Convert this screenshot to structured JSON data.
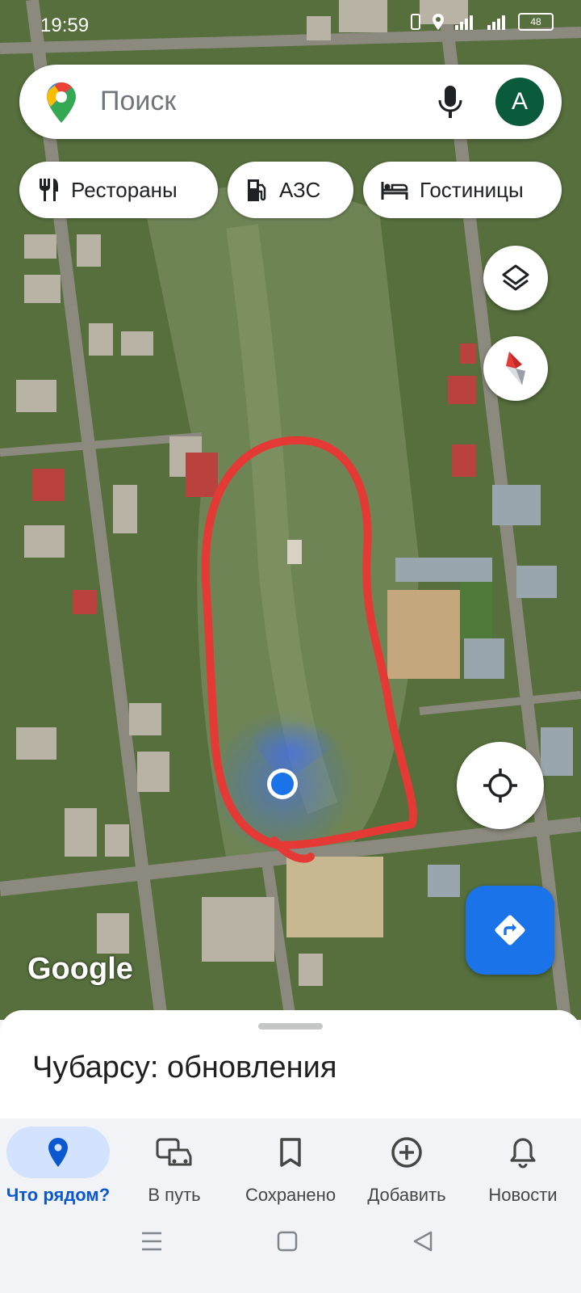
{
  "status_bar": {
    "time": "19:59",
    "battery": "48"
  },
  "search": {
    "placeholder": "Поиск",
    "avatar_letter": "А"
  },
  "chips": [
    {
      "label": "Рестораны",
      "icon": "restaurant-icon"
    },
    {
      "label": "АЗС",
      "icon": "gas-station-icon"
    },
    {
      "label": "Гостиницы",
      "icon": "hotel-icon"
    }
  ],
  "map": {
    "attribution": "Google",
    "annotation_color": "#e53935",
    "location_dot_color": "#1a73e8"
  },
  "bottom_sheet": {
    "title": "Чубарсу: обновления"
  },
  "bottom_nav": {
    "items": [
      {
        "label": "Что рядом?",
        "icon": "location-pin-icon",
        "active": true
      },
      {
        "label": "В путь",
        "icon": "commute-icon",
        "active": false
      },
      {
        "label": "Сохранено",
        "icon": "bookmark-icon",
        "active": false
      },
      {
        "label": "Добавить",
        "icon": "add-circle-icon",
        "active": false
      },
      {
        "label": "Новости",
        "icon": "bell-icon",
        "active": false
      }
    ]
  },
  "colors": {
    "accent": "#1a73e8",
    "active_nav_bg": "#d3e3fd",
    "avatar_bg": "#0a5b3c"
  }
}
